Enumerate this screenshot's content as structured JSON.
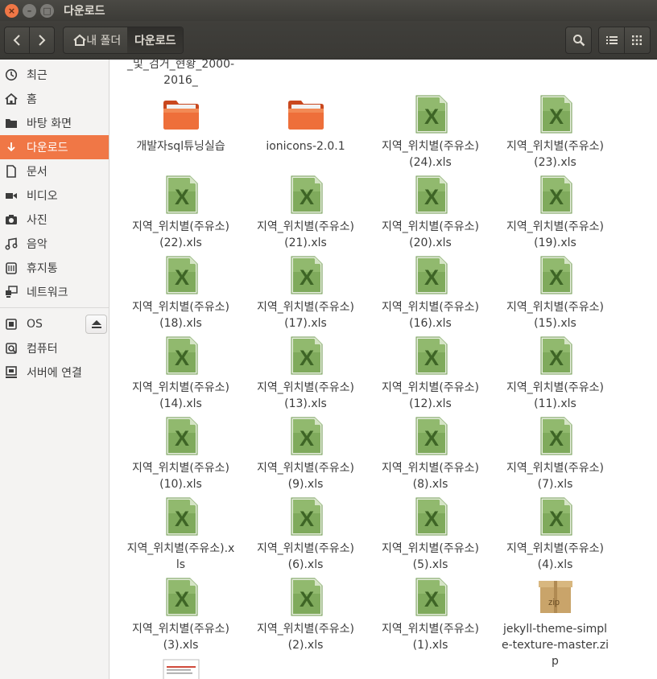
{
  "window": {
    "title": "다운로드"
  },
  "toolbar": {
    "breadcrumb_home": "내 폴더",
    "breadcrumb_current": "다운로드"
  },
  "sidebar": {
    "items": [
      {
        "label": "최근",
        "icon": "clock-icon"
      },
      {
        "label": "홈",
        "icon": "home-icon"
      },
      {
        "label": "바탕 화면",
        "icon": "desktop-folder-icon"
      },
      {
        "label": "다운로드",
        "icon": "download-icon",
        "active": true
      },
      {
        "label": "문서",
        "icon": "document-icon"
      },
      {
        "label": "비디오",
        "icon": "video-icon"
      },
      {
        "label": "사진",
        "icon": "camera-icon"
      },
      {
        "label": "음악",
        "icon": "music-icon"
      },
      {
        "label": "휴지통",
        "icon": "trash-icon"
      },
      {
        "label": "네트워크",
        "icon": "network-icon"
      }
    ],
    "devices": [
      {
        "label": "OS",
        "icon": "drive-icon"
      },
      {
        "label": "컴퓨터",
        "icon": "computer-icon"
      },
      {
        "label": "서버에 연결",
        "icon": "server-icon"
      }
    ]
  },
  "content": {
    "partial_label": "_및_검거_현황_2000-2016_",
    "files": [
      {
        "name": "개발자sql튜닝실습",
        "type": "folder"
      },
      {
        "name": "ionicons-2.0.1",
        "type": "folder"
      },
      {
        "name": "지역_위치별(주유소)(24).xls",
        "type": "xls"
      },
      {
        "name": "지역_위치별(주유소)(23).xls",
        "type": "xls"
      },
      {
        "name": "지역_위치별(주유소)(22).xls",
        "type": "xls"
      },
      {
        "name": "지역_위치별(주유소)(21).xls",
        "type": "xls"
      },
      {
        "name": "지역_위치별(주유소)(20).xls",
        "type": "xls"
      },
      {
        "name": "지역_위치별(주유소)(19).xls",
        "type": "xls"
      },
      {
        "name": "지역_위치별(주유소)(18).xls",
        "type": "xls"
      },
      {
        "name": "지역_위치별(주유소)(17).xls",
        "type": "xls"
      },
      {
        "name": "지역_위치별(주유소)(16).xls",
        "type": "xls"
      },
      {
        "name": "지역_위치별(주유소)(15).xls",
        "type": "xls"
      },
      {
        "name": "지역_위치별(주유소)(14).xls",
        "type": "xls"
      },
      {
        "name": "지역_위치별(주유소)(13).xls",
        "type": "xls"
      },
      {
        "name": "지역_위치별(주유소)(12).xls",
        "type": "xls"
      },
      {
        "name": "지역_위치별(주유소)(11).xls",
        "type": "xls"
      },
      {
        "name": "지역_위치별(주유소)(10).xls",
        "type": "xls"
      },
      {
        "name": "지역_위치별(주유소)(9).xls",
        "type": "xls"
      },
      {
        "name": "지역_위치별(주유소)(8).xls",
        "type": "xls"
      },
      {
        "name": "지역_위치별(주유소)(7).xls",
        "type": "xls"
      },
      {
        "name": "지역_위치별(주유소).xls",
        "type": "xls"
      },
      {
        "name": "지역_위치별(주유소)(6).xls",
        "type": "xls"
      },
      {
        "name": "지역_위치별(주유소)(5).xls",
        "type": "xls"
      },
      {
        "name": "지역_위치별(주유소)(4).xls",
        "type": "xls"
      },
      {
        "name": "지역_위치별(주유소)(3).xls",
        "type": "xls"
      },
      {
        "name": "지역_위치별(주유소)(2).xls",
        "type": "xls"
      },
      {
        "name": "지역_위치별(주유소)(1).xls",
        "type": "xls"
      },
      {
        "name": "jekyll-theme-simple-texture-master.zip",
        "type": "zip",
        "badge": "zip"
      },
      {
        "name": "",
        "type": "document"
      }
    ]
  },
  "colors": {
    "accent": "#f07746",
    "folder": "#e9622d",
    "excel": "#5c8f3c"
  }
}
